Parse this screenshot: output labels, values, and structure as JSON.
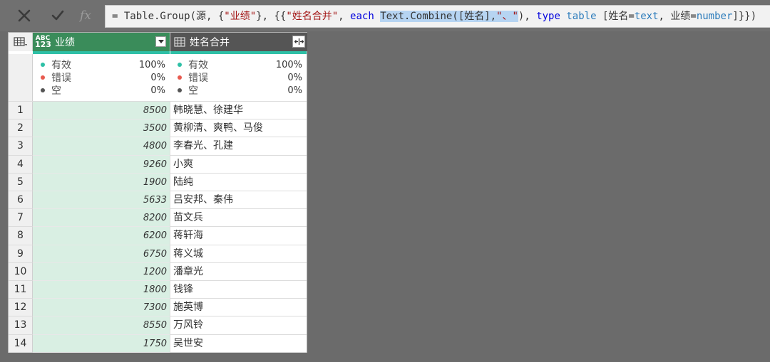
{
  "formula_bar": {
    "cancel_icon": "close-icon",
    "confirm_icon": "check-icon",
    "fx_label": "fx",
    "formula": {
      "p1": "= Table.Group(源, {",
      "s1": "\"业绩\"",
      "p2": "}, {{",
      "s2": "\"姓名合并\"",
      "p3": ", ",
      "k1": "each",
      "p4": " ",
      "sel1": "Text.Combine([姓名],",
      "sel2": "\"、\"",
      "p5": "), ",
      "k2": "type",
      "p6": " ",
      "t1": "table",
      "p7": " [姓名=",
      "t2": "text",
      "p8": ", 业绩=",
      "t3": "number",
      "p9": "]}})"
    }
  },
  "table": {
    "columns": [
      {
        "title": "业绩",
        "type_icon_top": "ABC",
        "type_icon_bottom": "123"
      },
      {
        "title": "姓名合并"
      }
    ],
    "quality": {
      "labels": [
        "有效",
        "错误",
        "空"
      ],
      "colors": [
        "#2ec0a6",
        "#e85a4f",
        "#555555"
      ],
      "perf": [
        "100%",
        "0%",
        "0%"
      ],
      "names": [
        "100%",
        "0%",
        "0%"
      ]
    },
    "rows": [
      {
        "n": "1",
        "perf": "8500",
        "names": "韩晓慧、徐建华"
      },
      {
        "n": "2",
        "perf": "3500",
        "names": "黄柳清、爽鸭、马俊"
      },
      {
        "n": "3",
        "perf": "4800",
        "names": "李春光、孔建"
      },
      {
        "n": "4",
        "perf": "9260",
        "names": "小爽"
      },
      {
        "n": "5",
        "perf": "1900",
        "names": "陆纯"
      },
      {
        "n": "6",
        "perf": "5633",
        "names": "吕安邦、秦伟"
      },
      {
        "n": "7",
        "perf": "8200",
        "names": "苗文兵"
      },
      {
        "n": "8",
        "perf": "6200",
        "names": "蒋轩海"
      },
      {
        "n": "9",
        "perf": "6750",
        "names": "蒋义城"
      },
      {
        "n": "10",
        "perf": "1200",
        "names": "潘章光"
      },
      {
        "n": "11",
        "perf": "1800",
        "names": "钱锋"
      },
      {
        "n": "12",
        "perf": "7300",
        "names": "施英博"
      },
      {
        "n": "13",
        "perf": "8550",
        "names": "万风铃"
      },
      {
        "n": "14",
        "perf": "1750",
        "names": "吴世安"
      }
    ]
  }
}
